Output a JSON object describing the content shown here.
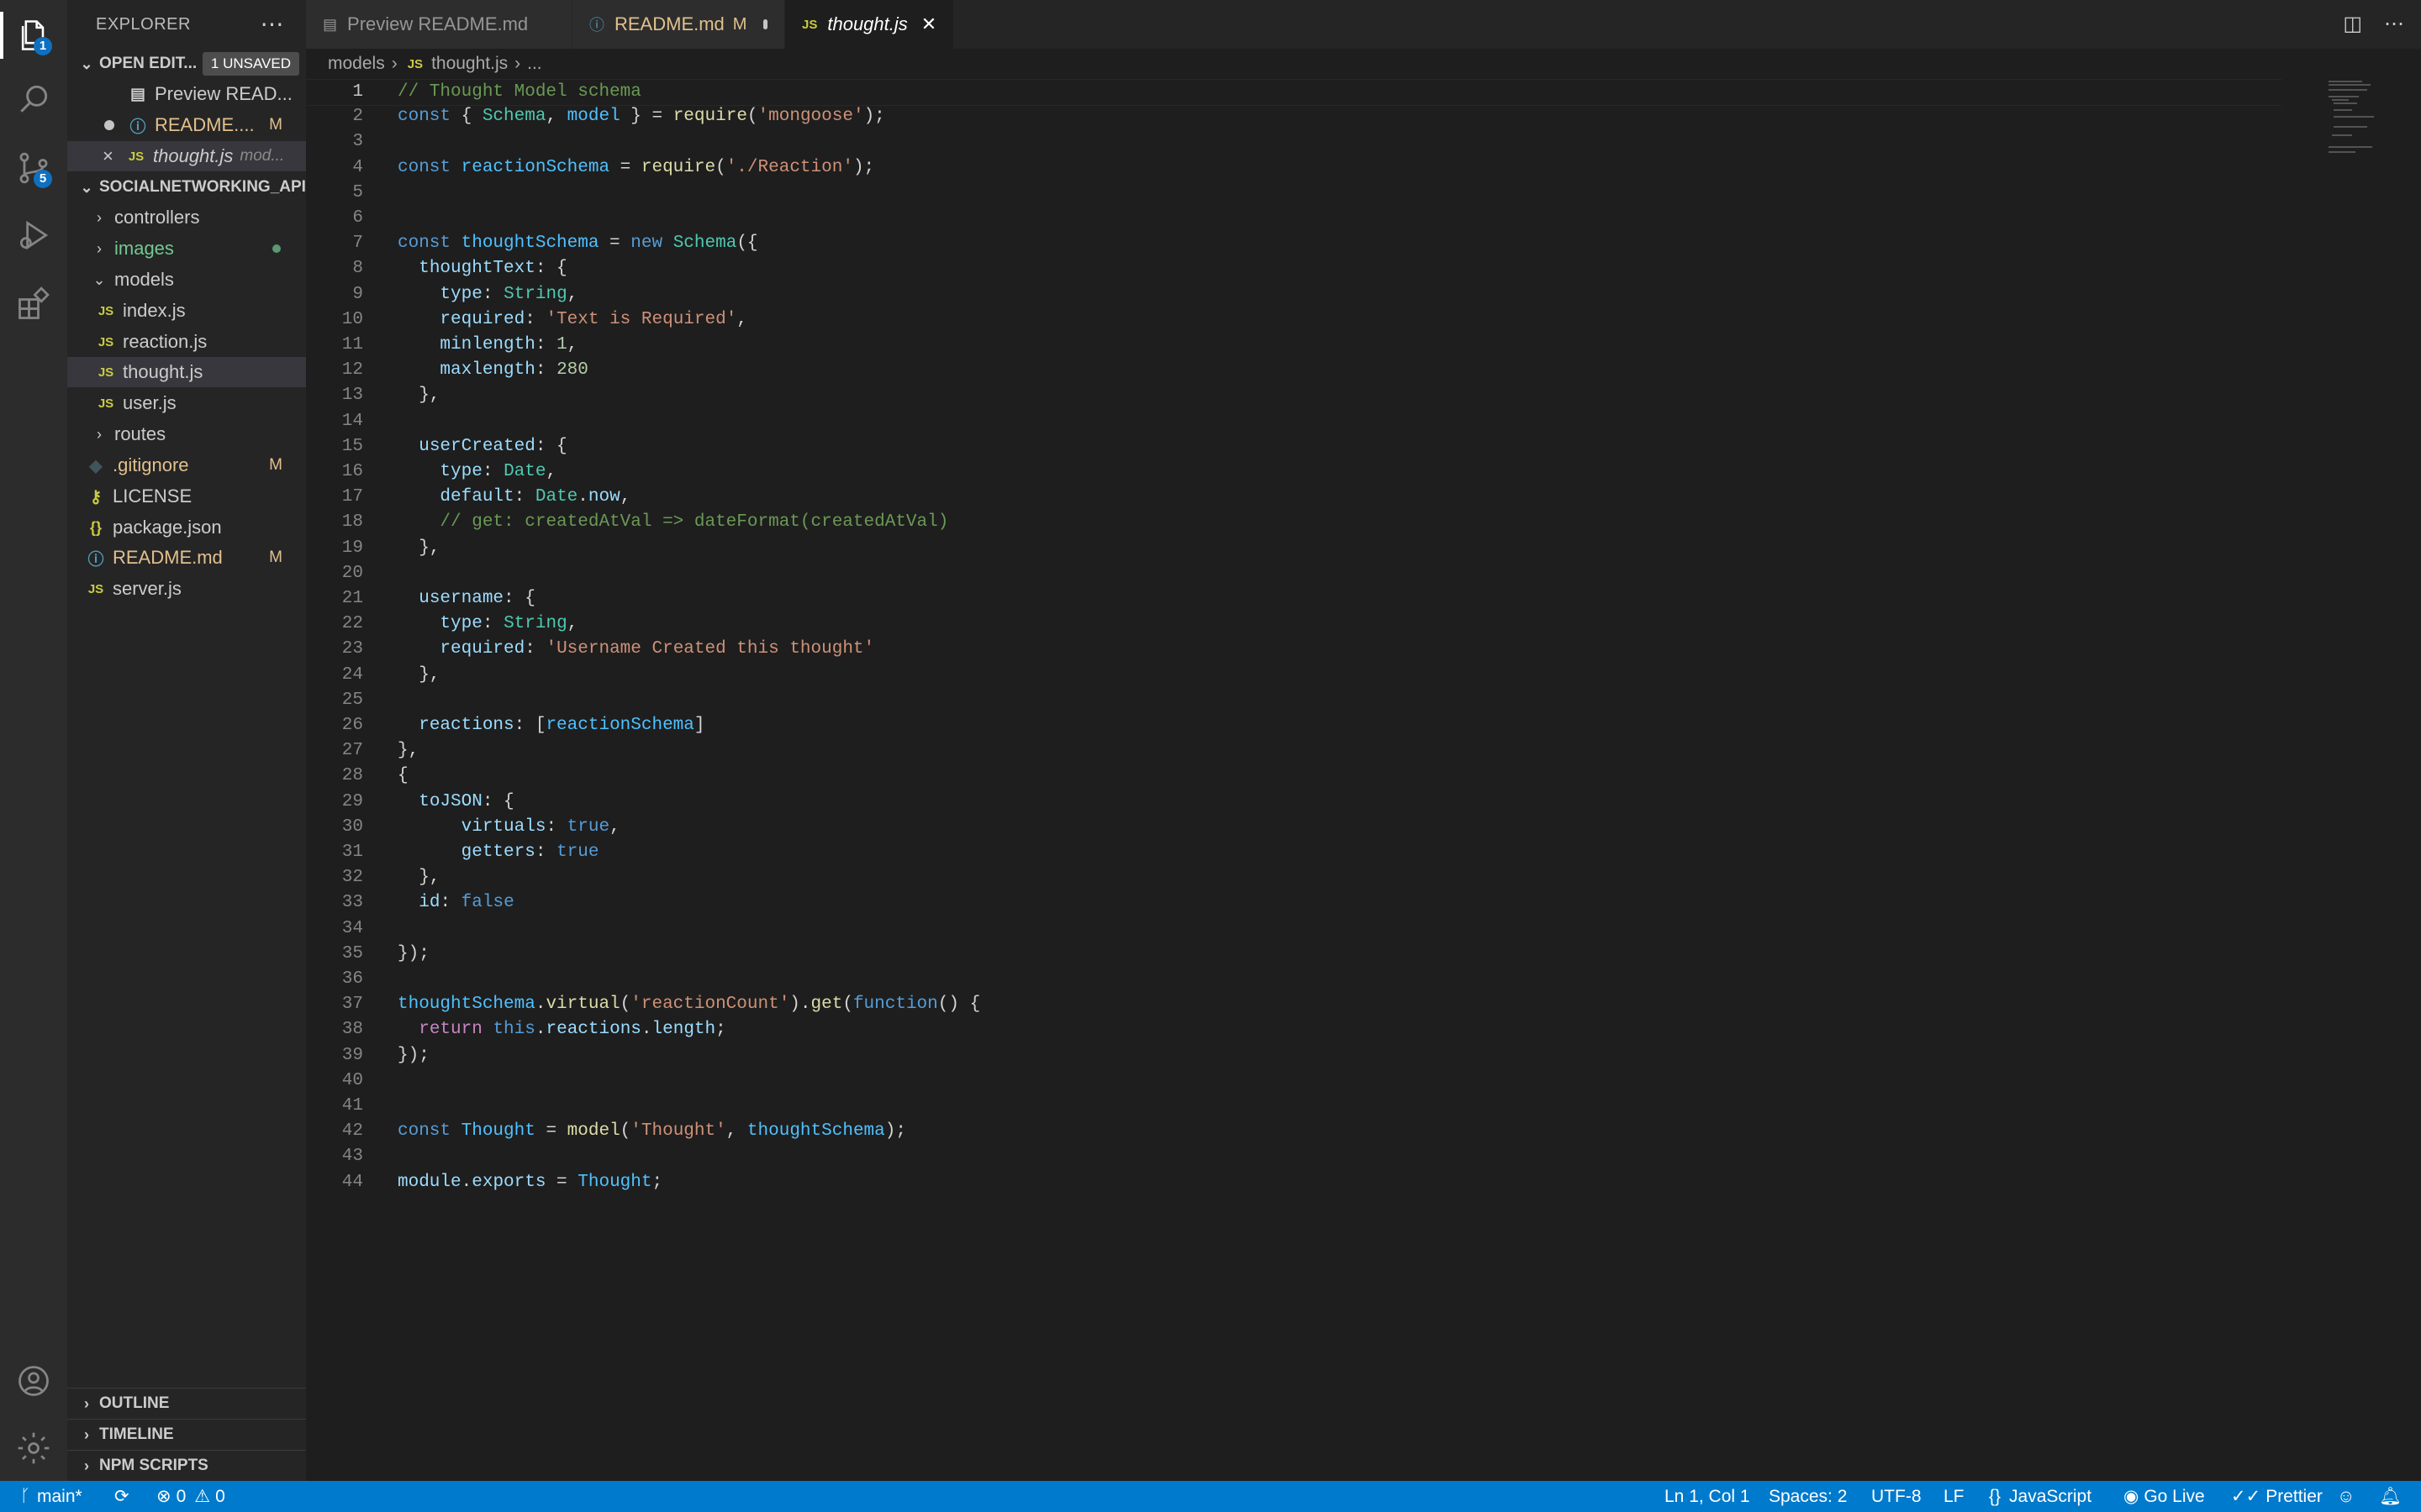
{
  "sidebar": {
    "title": "EXPLORER",
    "open_editors": {
      "label": "OPEN EDIT...",
      "unsaved_badge": "1 UNSAVED",
      "items": [
        {
          "label": "Preview READ...",
          "desc": "",
          "mark": ""
        },
        {
          "label": "README....",
          "desc": "",
          "mark": "M"
        },
        {
          "label": "thought.js",
          "desc": "mod...",
          "mark": ""
        }
      ]
    },
    "project": {
      "label": "SOCIALNETWORKING_API",
      "items": [
        {
          "label": "controllers",
          "mark": ""
        },
        {
          "label": "images",
          "mark": ""
        },
        {
          "label": "models",
          "mark": ""
        },
        {
          "label": "index.js",
          "mark": ""
        },
        {
          "label": "reaction.js",
          "mark": ""
        },
        {
          "label": "thought.js",
          "mark": ""
        },
        {
          "label": "user.js",
          "mark": ""
        },
        {
          "label": "routes",
          "mark": ""
        },
        {
          "label": ".gitignore",
          "mark": "M"
        },
        {
          "label": "LICENSE",
          "mark": ""
        },
        {
          "label": "package.json",
          "mark": ""
        },
        {
          "label": "README.md",
          "mark": "M"
        },
        {
          "label": "server.js",
          "mark": ""
        }
      ]
    },
    "bottom_sections": [
      "OUTLINE",
      "TIMELINE",
      "NPM SCRIPTS"
    ]
  },
  "activity": {
    "explorer_badge": "1",
    "scm_badge": "5"
  },
  "tabs": [
    {
      "label": "Preview README.md",
      "mark": ""
    },
    {
      "label": "README.md",
      "mark": "M"
    },
    {
      "label": "thought.js",
      "mark": ""
    }
  ],
  "breadcrumb": {
    "folder": "models",
    "file": "thought.js",
    "more": "..."
  },
  "code": {
    "lines": [
      "// Thought Model schema",
      "const { Schema, model } = require('mongoose');",
      "",
      "const reactionSchema = require('./Reaction');",
      "",
      "",
      "const thoughtSchema = new Schema({",
      "  thoughtText: {",
      "    type: String,",
      "    required: 'Text is Required',",
      "    minlength: 1,",
      "    maxlength: 280",
      "  },",
      "",
      "  userCreated: {",
      "    type: Date,",
      "    default: Date.now,",
      "    // get: createdAtVal => dateFormat(createdAtVal)",
      "  },",
      "",
      "  username: {",
      "    type: String,",
      "    required: 'Username Created this thought'",
      "  },",
      "",
      "  reactions: [reactionSchema]",
      "},",
      "{",
      "  toJSON: {",
      "      virtuals: true,",
      "      getters: true",
      "  },",
      "  id: false",
      "",
      "});",
      "",
      "thoughtSchema.virtual('reactionCount').get(function() {",
      "  return this.reactions.length;",
      "});",
      "",
      "",
      "const Thought = model('Thought', thoughtSchema);",
      "",
      "module.exports = Thought;"
    ]
  },
  "statusbar": {
    "branch": "main*",
    "errors": "0",
    "warnings": "0",
    "position": "Ln 1, Col 1",
    "spaces": "Spaces: 2",
    "encoding": "UTF-8",
    "eol": "LF",
    "language": "JavaScript",
    "golive": "Go Live",
    "prettier": "Prettier"
  }
}
